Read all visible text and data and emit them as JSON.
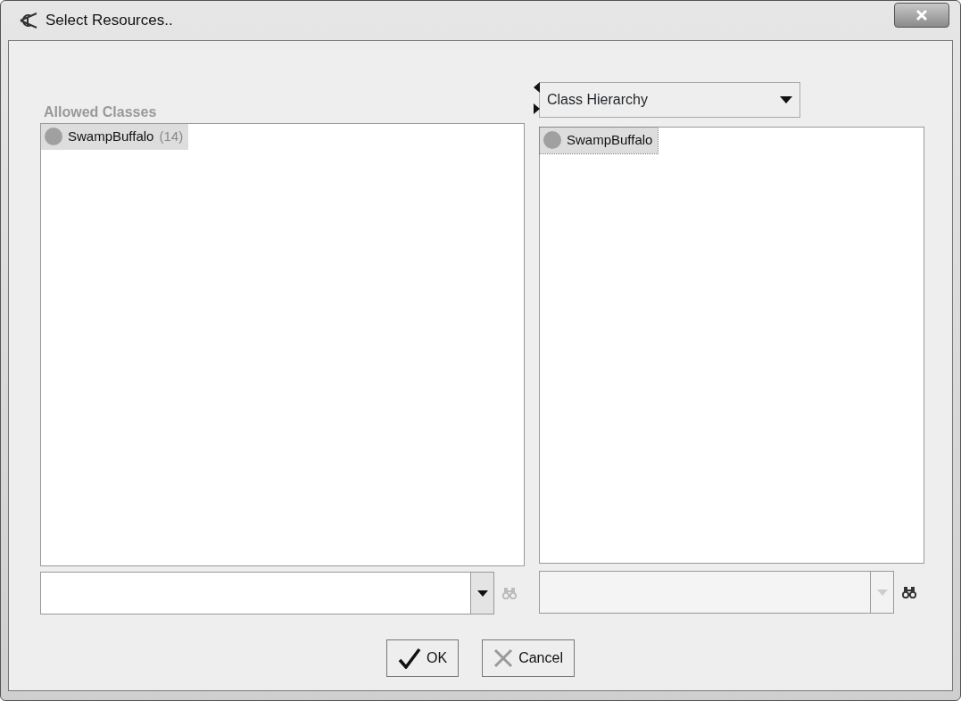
{
  "window": {
    "title": "Select Resources.."
  },
  "left_panel": {
    "title": "Allowed Classes",
    "items": [
      {
        "name": "SwampBuffalo",
        "count": "(14)",
        "selected": true
      }
    ],
    "search": {
      "disabled": false,
      "find_disabled": true
    }
  },
  "right_panel": {
    "view_selector": "Class Hierarchy",
    "items": [
      {
        "name": "SwampBuffalo",
        "selected": true
      }
    ],
    "search": {
      "disabled": true,
      "find_disabled": false
    }
  },
  "buttons": [
    {
      "kind": "ok",
      "label": "OK"
    },
    {
      "kind": "cancel",
      "label": "Cancel"
    }
  ]
}
